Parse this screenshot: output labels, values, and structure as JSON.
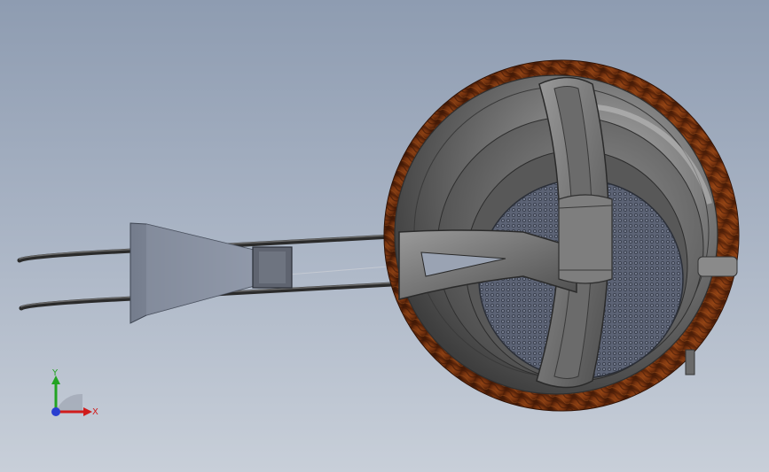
{
  "viewport": {
    "background_top": "#8e9cb1",
    "background_bottom": "#c8cfd9"
  },
  "model": {
    "shell_wood_color": "#8a3d12",
    "shell_grey_color": "#5c5c5c",
    "mesh_color": "#4a5160"
  },
  "triad": {
    "x_label": "X",
    "y_label": "Y",
    "x_color": "#d01c1c",
    "y_color": "#22a322",
    "z_color": "#2a3fd0"
  }
}
